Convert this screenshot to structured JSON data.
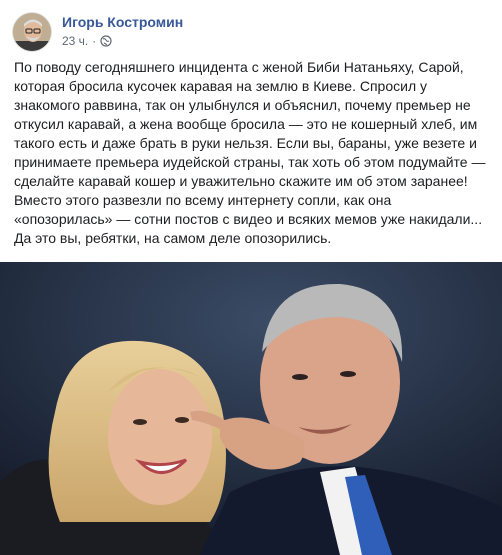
{
  "post": {
    "author": "Игорь Костромин",
    "time": "23 ч.",
    "separator": "·",
    "privacy_icon": "globe-icon",
    "text": "По поводу сегодняшнего инцидента с женой Биби Натаньяху, Сарой, которая бросила кусочек каравая на землю в Киеве. Спросил у знакомого раввина, так он улыбнулся и объяснил, почему премьер не откусил каравай, а жена вообще бросила — это не кошерный хлеб, им такого есть и даже брать в руки нельзя. Если вы, бараны, уже везете и принимаете премьера иудейской страны, так хоть об этом подумайте — сделайте каравай кошер и уважительно скажите им об этом заранее! Вместо этого развезли по всему интернету сопли, как она «опозорилась» — сотни постов с видео и всяких мемов уже накидали... Да это вы, ребятки, на самом деле опозорились.",
    "photo_subject": "photo of a smiling woman with blonde hair and a smiling man in a dark suit pointing at the camera"
  }
}
